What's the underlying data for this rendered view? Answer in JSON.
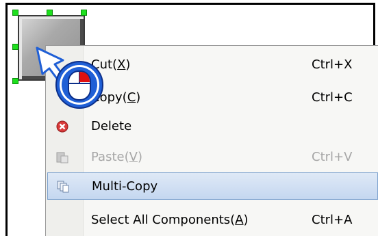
{
  "context_menu": {
    "items": [
      {
        "pre": "Cu",
        "text": "t(",
        "mnemonic": "X",
        "post": ")",
        "shortcut": "Ctrl+X",
        "icon": "cut-icon",
        "disabled": false,
        "highlighted": false
      },
      {
        "pre": "Co",
        "text": "py(",
        "mnemonic": "C",
        "post": ")",
        "shortcut": "Ctrl+C",
        "icon": "copy-icon",
        "disabled": false,
        "highlighted": false
      },
      {
        "pre": "",
        "text": "Delete",
        "mnemonic": "",
        "post": "",
        "shortcut": "",
        "icon": "delete-icon",
        "disabled": false,
        "highlighted": false
      },
      {
        "pre": "",
        "text": "Paste(",
        "mnemonic": "V",
        "post": ")",
        "shortcut": "Ctrl+V",
        "icon": "paste-icon",
        "disabled": true,
        "highlighted": false
      },
      {
        "pre": "",
        "text": "Multi-Copy",
        "mnemonic": "",
        "post": "",
        "shortcut": "",
        "icon": "multi-copy-icon",
        "disabled": false,
        "highlighted": true
      },
      {
        "pre": "",
        "text": "Select All Components(",
        "mnemonic": "A",
        "post": ")",
        "shortcut": "Ctrl+A",
        "icon": "",
        "disabled": false,
        "highlighted": false
      }
    ]
  },
  "colors": {
    "selection_handle": "#1ee01e",
    "highlight": "#c4d7f0",
    "cursor_overlay": "#1f5fd6",
    "mouse_button": "#e01010"
  },
  "overlay": {
    "icon": "mouse-right-click-icon"
  }
}
